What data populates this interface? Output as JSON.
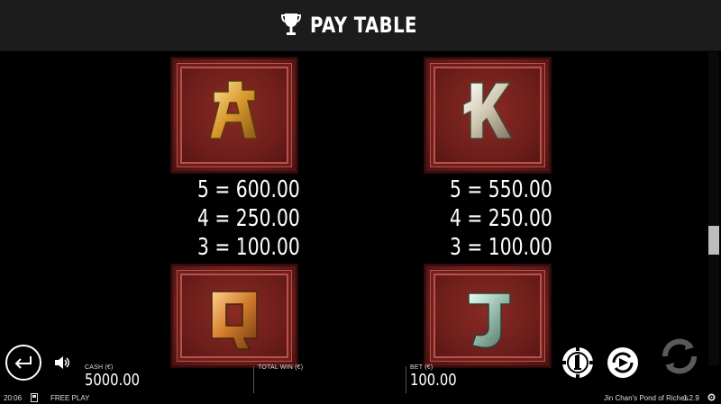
{
  "header": {
    "title": "PAY TABLE",
    "icon": "trophy-icon"
  },
  "symbols": [
    {
      "name": "A",
      "color": "#e8b04a",
      "pays": [
        "5 = 600.00",
        "4 = 250.00",
        "3 = 100.00"
      ]
    },
    {
      "name": "K",
      "color": "#d9d3c2",
      "pays": [
        "5 = 550.00",
        "4 = 250.00",
        "3 = 100.00"
      ]
    },
    {
      "name": "Q",
      "color": "#d98a3a"
    },
    {
      "name": "J",
      "color": "#9ec6b8"
    }
  ],
  "scroll": {
    "position": 0.61
  },
  "balance": {
    "cash_label": "CASH (€)",
    "cash_value": "5000.00",
    "total_win_label": "TOTAL WIN (€)",
    "total_win_value": "",
    "bet_label": "BET (€)",
    "bet_value": "100.00"
  },
  "footer": {
    "time": "20:06",
    "mode": "FREE PLAY",
    "game_title": "Jin Chan's Pond of Riches",
    "version": "1.2.9"
  },
  "colors": {
    "tile_red": "#6e1e1b",
    "border_pink": "#b9534a",
    "header_bg": "#1c1c1c"
  }
}
